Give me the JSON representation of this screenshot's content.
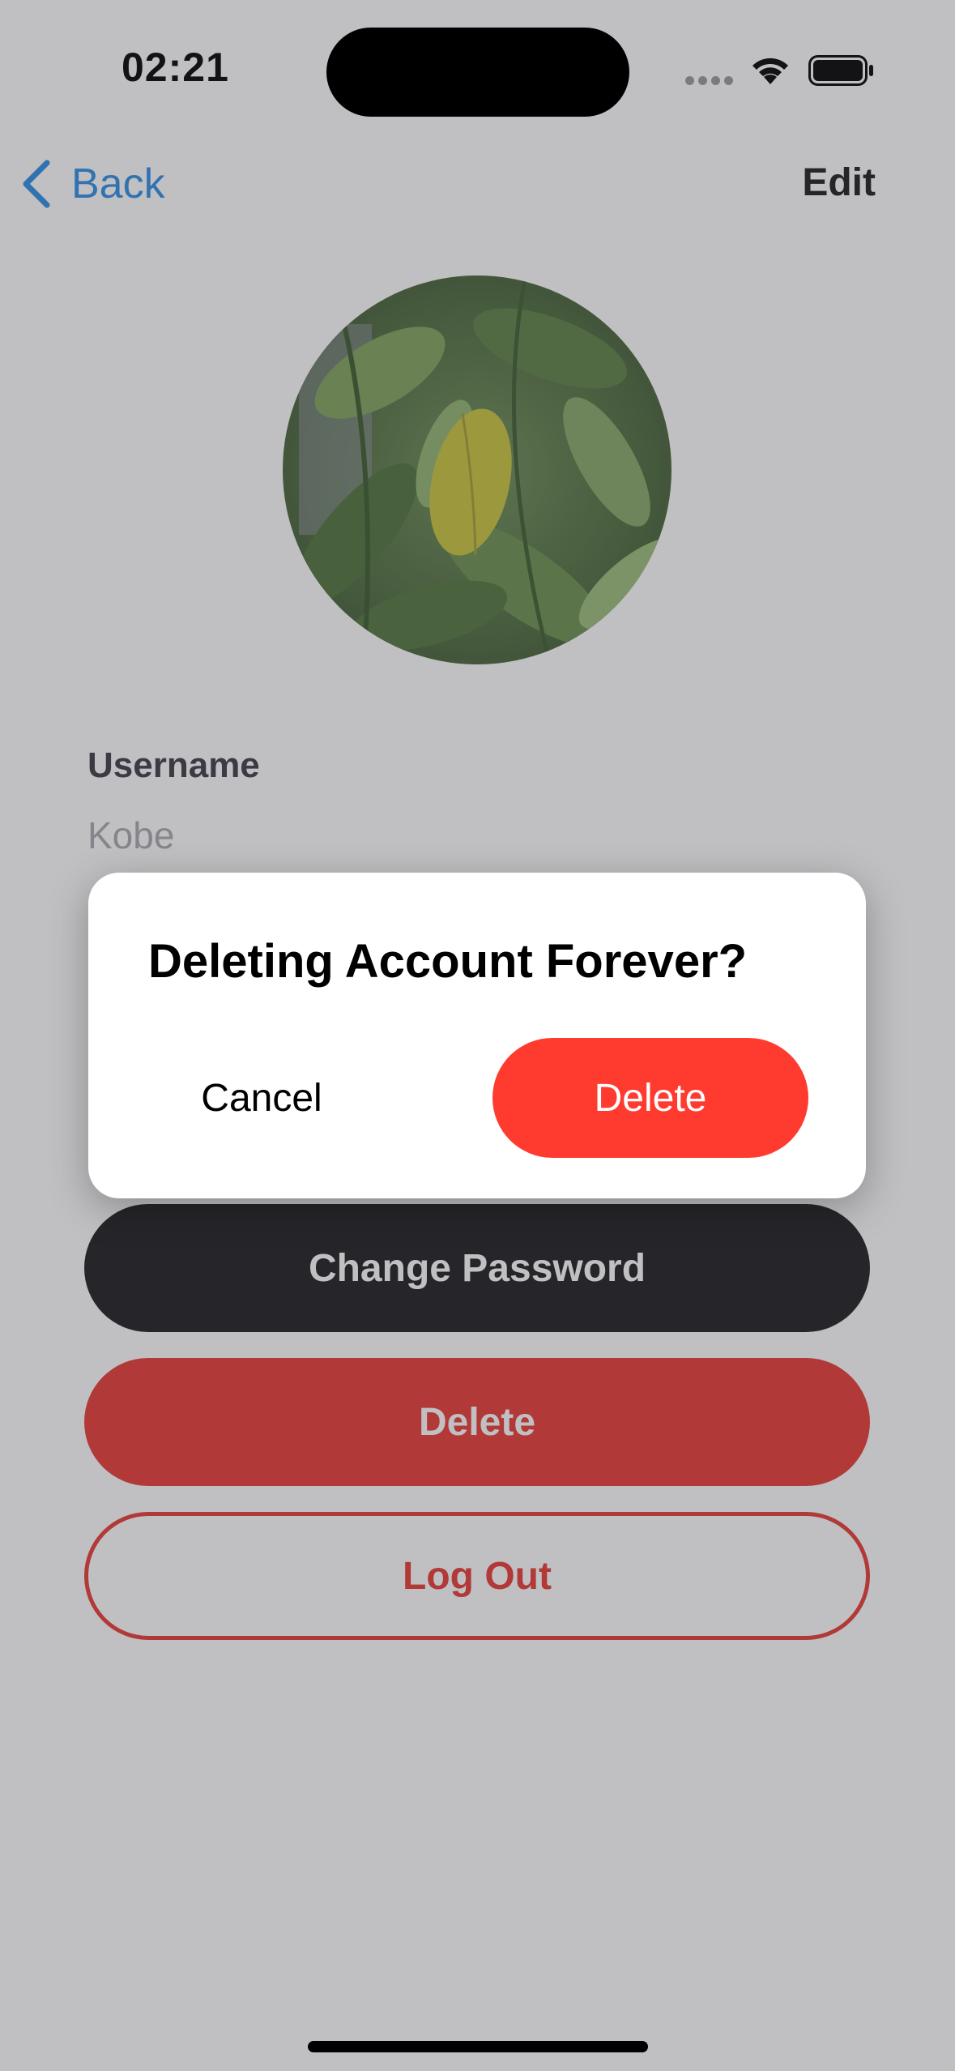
{
  "status_bar": {
    "time": "02:21",
    "icons": [
      "signal-icon",
      "wifi-icon",
      "battery-icon"
    ]
  },
  "nav": {
    "back_label": "Back",
    "edit_label": "Edit"
  },
  "profile": {
    "field_label": "Username",
    "field_value": "Kobe"
  },
  "actions": {
    "change_password_label": "Change Password",
    "delete_label": "Delete",
    "logout_label": "Log Out"
  },
  "alert": {
    "title": "Deleting Account Forever?",
    "cancel_label": "Cancel",
    "delete_label": "Delete"
  },
  "colors": {
    "accent": "#2f8de4",
    "destructive": "#ff3b30",
    "dark_button": "#1c1c1e"
  }
}
